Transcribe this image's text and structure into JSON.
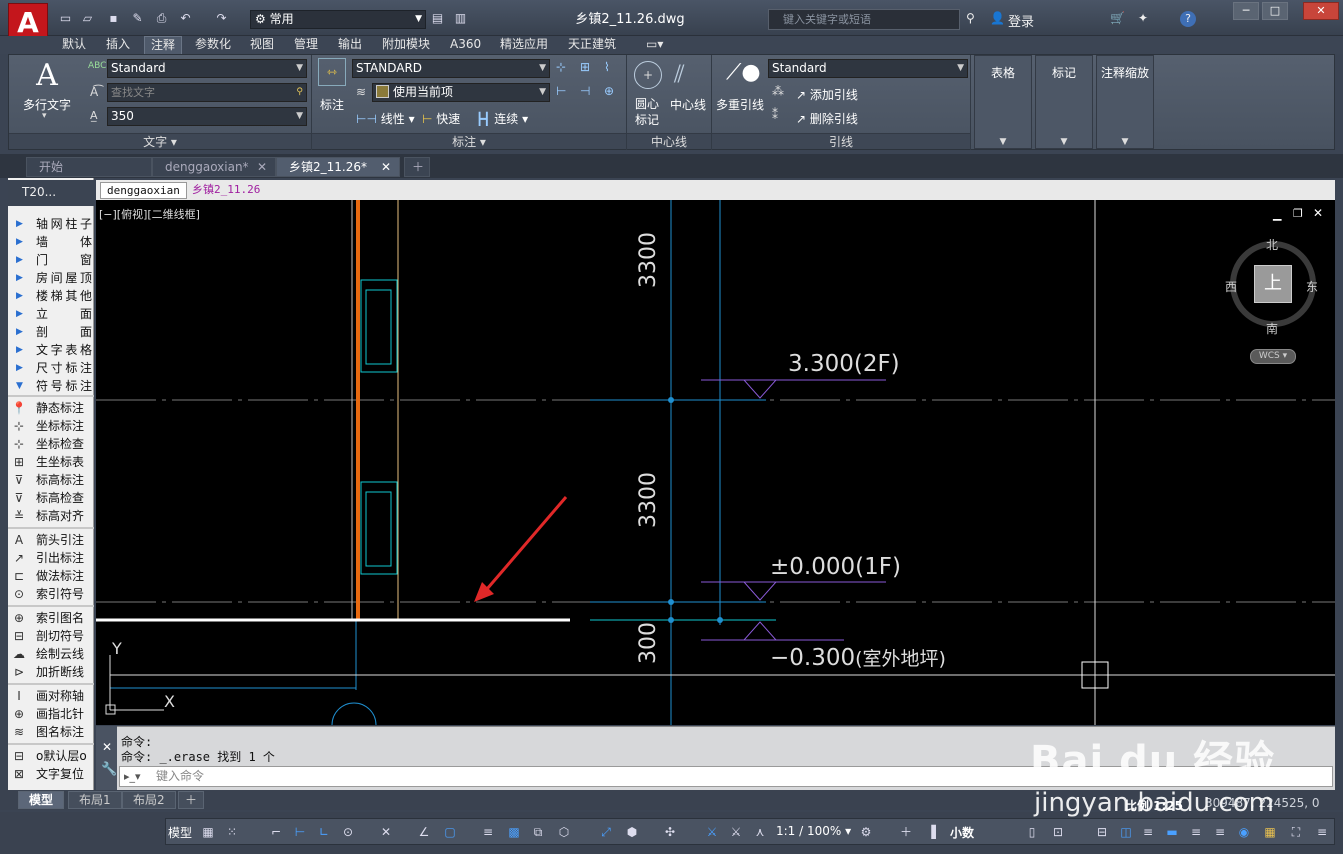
{
  "title_bar": {
    "workspace": "常用",
    "doc_title": "乡镇2_11.26.dwg",
    "search_placeholder": "键入关键字或短语",
    "login": "登录"
  },
  "ribbon_tabs": [
    "默认",
    "插入",
    "注释",
    "参数化",
    "视图",
    "管理",
    "输出",
    "附加模块",
    "A360",
    "精选应用",
    "天正建筑"
  ],
  "ribbon": {
    "text_panel": {
      "multiline_text": "多行文字",
      "text_style": "Standard",
      "find_text_placeholder": "查找文字",
      "text_height": "350",
      "title": "文字 ▾"
    },
    "dim_panel": {
      "dimension": "标注",
      "dim_style": "STANDARD",
      "layer": "使用当前项",
      "linear": "线性",
      "quick": "快速",
      "continue": "连续",
      "title": "标注 ▾"
    },
    "centerline_panel": {
      "center_mark": "圆心\n标记",
      "center_mark_l1": "圆心",
      "center_mark_l2": "标记",
      "centerline": "中心线",
      "title": "中心线"
    },
    "leader_panel": {
      "multileader": "多重引线",
      "leader_style": "Standard",
      "add_leader": "添加引线",
      "remove_leader": "删除引线",
      "title": "引线"
    },
    "extra_panels": [
      "表格",
      "标记",
      "注释缩放"
    ]
  },
  "doc_tabs": [
    {
      "label": "开始"
    },
    {
      "label": "denggaoxian*"
    },
    {
      "label": "乡镇2_11.26*"
    }
  ],
  "palette": {
    "header": "T20...",
    "groups_a": [
      "轴网柱子",
      "墙　体",
      "门　窗",
      "房间屋顶",
      "楼梯其他",
      "立　面",
      "剖　面",
      "文字表格",
      "尺寸标注",
      "符号标注"
    ],
    "items_b": [
      "静态标注",
      "坐标标注",
      "坐标检查",
      "生坐标表",
      "标高标注",
      "标高检查",
      "标高对齐"
    ],
    "items_c": [
      "箭头引注",
      "引出标注",
      "做法标注",
      "索引符号"
    ],
    "items_d": [
      "索引图名",
      "剖切符号",
      "绘制云线",
      "加折断线"
    ],
    "items_e": [
      "画对称轴",
      "画指北针",
      "图名标注"
    ],
    "items_f": [
      "o默认层o",
      "文字复位"
    ]
  },
  "sub_tabs": [
    "denggaoxian",
    "乡镇2_11.26"
  ],
  "viewport": {
    "label": "[−][俯视][二维线框]",
    "dims": [
      "3300",
      "3300",
      "300"
    ],
    "levels": [
      "3.300(2F)",
      "±0.000(1F)",
      "−0.300(室外地坪)"
    ],
    "level_l3_num": "−0.300",
    "level_l3_txt": "(室外地坪)",
    "compass": {
      "n": "北",
      "s": "南",
      "e": "东",
      "w": "西",
      "top": "上",
      "wcs": "WCS"
    },
    "ucs_x": "X",
    "ucs_y": "Y"
  },
  "command": {
    "line1": "命令:",
    "line2": "命令: _.erase 找到 1 个",
    "input_placeholder": "键入命令"
  },
  "layout_tabs": [
    "模型",
    "布局1",
    "布局2"
  ],
  "status": {
    "model": "模型",
    "scale_label": "比例 1:25",
    "coords": "309487, 224525, 0",
    "annotation_scale": "1:1 / 100%",
    "units": "小数"
  },
  "watermark": {
    "brand": "Bai du 经验",
    "url": "jingyan.baidu.com"
  }
}
